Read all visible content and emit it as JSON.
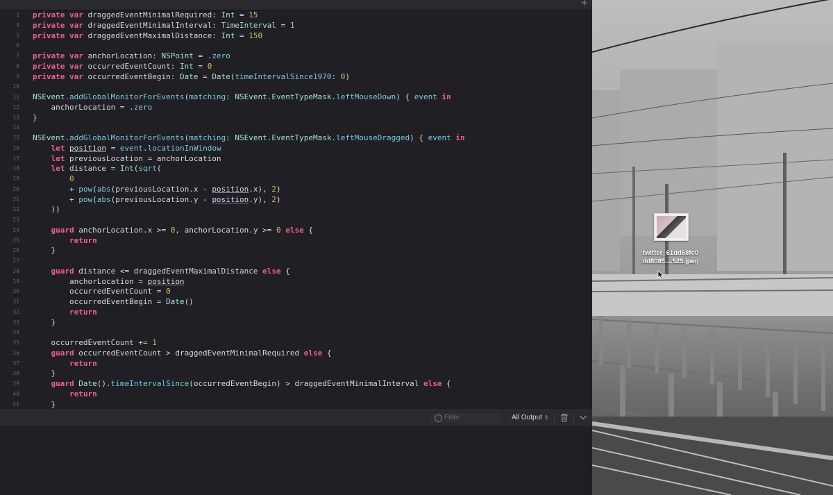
{
  "editor": {
    "add_tab": "+",
    "lines": [
      {
        "n": "3",
        "t": [
          [
            "kw",
            "private var "
          ],
          [
            "p",
            "draggedEventMinimalRequired: "
          ],
          [
            "typ",
            "Int"
          ],
          [
            "p",
            " = "
          ],
          [
            "num",
            "15"
          ]
        ]
      },
      {
        "n": "4",
        "t": [
          [
            "kw",
            "private var "
          ],
          [
            "p",
            "draggedEventMinimalInterval: "
          ],
          [
            "typ",
            "TimeInterval"
          ],
          [
            "p",
            " = "
          ],
          [
            "num",
            "1"
          ]
        ]
      },
      {
        "n": "5",
        "t": [
          [
            "kw",
            "private var "
          ],
          [
            "p",
            "draggedEventMaximalDistance: "
          ],
          [
            "typ",
            "Int"
          ],
          [
            "p",
            " = "
          ],
          [
            "num",
            "150"
          ]
        ]
      },
      {
        "n": "6",
        "t": []
      },
      {
        "n": "7",
        "t": [
          [
            "kw",
            "private var "
          ],
          [
            "p",
            "anchorLocation: "
          ],
          [
            "typ",
            "NSPoint"
          ],
          [
            "p",
            " = ."
          ],
          [
            "fn",
            "zero"
          ]
        ]
      },
      {
        "n": "8",
        "t": [
          [
            "kw",
            "private var "
          ],
          [
            "p",
            "occurredEventCount: "
          ],
          [
            "typ",
            "Int"
          ],
          [
            "p",
            " = "
          ],
          [
            "num",
            "0"
          ]
        ]
      },
      {
        "n": "9",
        "t": [
          [
            "kw",
            "private var "
          ],
          [
            "p",
            "occurredEventBegin: "
          ],
          [
            "typ",
            "Date"
          ],
          [
            "p",
            " = "
          ],
          [
            "typ",
            "Date"
          ],
          [
            "p",
            "("
          ],
          [
            "fn",
            "timeIntervalSince1970"
          ],
          [
            "p",
            ": "
          ],
          [
            "num",
            "0"
          ],
          [
            "p",
            ")"
          ]
        ]
      },
      {
        "n": "10",
        "t": []
      },
      {
        "n": "11",
        "t": [
          [
            "typ",
            "NSEvent"
          ],
          [
            "p",
            "."
          ],
          [
            "fn",
            "addGlobalMonitorForEvents"
          ],
          [
            "p",
            "("
          ],
          [
            "fn",
            "matching"
          ],
          [
            "p",
            ": "
          ],
          [
            "typ",
            "NSEvent"
          ],
          [
            "p",
            "."
          ],
          [
            "typ",
            "EventTypeMask"
          ],
          [
            "p",
            "."
          ],
          [
            "fn",
            "leftMouseDown"
          ],
          [
            "p",
            ") { "
          ],
          [
            "fn",
            "event"
          ],
          [
            "p",
            " "
          ],
          [
            "kw",
            "in"
          ]
        ]
      },
      {
        "n": "12",
        "t": [
          [
            "p",
            "    anchorLocation = ."
          ],
          [
            "fn",
            "zero"
          ]
        ]
      },
      {
        "n": "13",
        "t": [
          [
            "p",
            "}"
          ]
        ]
      },
      {
        "n": "14",
        "t": []
      },
      {
        "n": "15",
        "t": [
          [
            "typ",
            "NSEvent"
          ],
          [
            "p",
            "."
          ],
          [
            "fn",
            "addGlobalMonitorForEvents"
          ],
          [
            "p",
            "("
          ],
          [
            "fn",
            "matching"
          ],
          [
            "p",
            ": "
          ],
          [
            "typ",
            "NSEvent"
          ],
          [
            "p",
            "."
          ],
          [
            "typ",
            "EventTypeMask"
          ],
          [
            "p",
            "."
          ],
          [
            "fn",
            "leftMouseDragged"
          ],
          [
            "p",
            ") { "
          ],
          [
            "fn",
            "event"
          ],
          [
            "p",
            " "
          ],
          [
            "kw",
            "in"
          ]
        ]
      },
      {
        "n": "16",
        "t": [
          [
            "p",
            "    "
          ],
          [
            "kw",
            "let "
          ],
          [
            "u",
            "position"
          ],
          [
            "p",
            " = "
          ],
          [
            "fn",
            "event"
          ],
          [
            "p",
            "."
          ],
          [
            "fn",
            "locationInWindow"
          ]
        ]
      },
      {
        "n": "17",
        "t": [
          [
            "p",
            "    "
          ],
          [
            "kw",
            "let "
          ],
          [
            "p",
            "previousLocation = anchorLocation"
          ]
        ]
      },
      {
        "n": "18",
        "t": [
          [
            "p",
            "    "
          ],
          [
            "kw",
            "let "
          ],
          [
            "p",
            "distance = "
          ],
          [
            "typ",
            "Int"
          ],
          [
            "p",
            "("
          ],
          [
            "fn",
            "sqrt"
          ],
          [
            "p",
            "("
          ]
        ]
      },
      {
        "n": "19",
        "t": [
          [
            "p",
            "        "
          ],
          [
            "num",
            "0"
          ]
        ]
      },
      {
        "n": "20",
        "t": [
          [
            "p",
            "        + "
          ],
          [
            "fn",
            "pow"
          ],
          [
            "p",
            "("
          ],
          [
            "fn",
            "abs"
          ],
          [
            "p",
            "(previousLocation.x - "
          ],
          [
            "u",
            "position"
          ],
          [
            "p",
            ".x), "
          ],
          [
            "num",
            "2"
          ],
          [
            "p",
            ")"
          ]
        ]
      },
      {
        "n": "21",
        "t": [
          [
            "p",
            "        + "
          ],
          [
            "fn",
            "pow"
          ],
          [
            "p",
            "("
          ],
          [
            "fn",
            "abs"
          ],
          [
            "p",
            "(previousLocation.y - "
          ],
          [
            "u",
            "position"
          ],
          [
            "p",
            ".y), "
          ],
          [
            "num",
            "2"
          ],
          [
            "p",
            ")"
          ]
        ]
      },
      {
        "n": "22",
        "t": [
          [
            "p",
            "    ))"
          ]
        ]
      },
      {
        "n": "23",
        "t": []
      },
      {
        "n": "24",
        "t": [
          [
            "p",
            "    "
          ],
          [
            "kw",
            "guard "
          ],
          [
            "p",
            "anchorLocation.x >= "
          ],
          [
            "num",
            "0"
          ],
          [
            "p",
            ", anchorLocation.y >= "
          ],
          [
            "num",
            "0"
          ],
          [
            "p",
            " "
          ],
          [
            "kw",
            "else"
          ],
          [
            "p",
            " {"
          ]
        ]
      },
      {
        "n": "25",
        "t": [
          [
            "p",
            "        "
          ],
          [
            "kw",
            "return"
          ]
        ]
      },
      {
        "n": "26",
        "t": [
          [
            "p",
            "    }"
          ]
        ]
      },
      {
        "n": "27",
        "t": []
      },
      {
        "n": "28",
        "t": [
          [
            "p",
            "    "
          ],
          [
            "kw",
            "guard "
          ],
          [
            "p",
            "distance <= draggedEventMaximalDistance "
          ],
          [
            "kw",
            "else"
          ],
          [
            "p",
            " {"
          ]
        ]
      },
      {
        "n": "29",
        "t": [
          [
            "p",
            "        anchorLocation = "
          ],
          [
            "u",
            "position"
          ]
        ]
      },
      {
        "n": "30",
        "t": [
          [
            "p",
            "        occurredEventCount = "
          ],
          [
            "num",
            "0"
          ]
        ]
      },
      {
        "n": "31",
        "t": [
          [
            "p",
            "        occurredEventBegin = "
          ],
          [
            "typ",
            "Date"
          ],
          [
            "p",
            "()"
          ]
        ]
      },
      {
        "n": "32",
        "t": [
          [
            "p",
            "        "
          ],
          [
            "kw",
            "return"
          ]
        ]
      },
      {
        "n": "33",
        "t": [
          [
            "p",
            "    }"
          ]
        ]
      },
      {
        "n": "34",
        "t": []
      },
      {
        "n": "35",
        "t": [
          [
            "p",
            "    occurredEventCount += "
          ],
          [
            "num",
            "1"
          ]
        ]
      },
      {
        "n": "36",
        "t": [
          [
            "p",
            "    "
          ],
          [
            "kw",
            "guard "
          ],
          [
            "p",
            "occurredEventCount > draggedEventMinimalRequired "
          ],
          [
            "kw",
            "else"
          ],
          [
            "p",
            " {"
          ]
        ]
      },
      {
        "n": "37",
        "t": [
          [
            "p",
            "        "
          ],
          [
            "kw",
            "return"
          ]
        ]
      },
      {
        "n": "38",
        "t": [
          [
            "p",
            "    }"
          ]
        ]
      },
      {
        "n": "39",
        "t": [
          [
            "p",
            "    "
          ],
          [
            "kw",
            "guard "
          ],
          [
            "typ",
            "Date"
          ],
          [
            "p",
            "()."
          ],
          [
            "fn",
            "timeIntervalSince"
          ],
          [
            "p",
            "(occurredEventBegin) > draggedEventMinimalInterval "
          ],
          [
            "kw",
            "else"
          ],
          [
            "p",
            " {"
          ]
        ]
      },
      {
        "n": "40",
        "t": [
          [
            "p",
            "        "
          ],
          [
            "kw",
            "return"
          ]
        ]
      },
      {
        "n": "41",
        "t": [
          [
            "p",
            "    }"
          ]
        ]
      }
    ]
  },
  "debug_bar": {
    "filter_placeholder": "Filter",
    "output_selector": "All Output",
    "output_chevron": "⇕"
  },
  "desktop": {
    "file_name_line1": "twitter_61dd68fc0",
    "file_name_line2": "dd8085....525.jpeg"
  },
  "colors": {
    "editor_bg": "#1f1f24",
    "keyword": "#ef5f95",
    "number": "#d3bd6f",
    "type": "#a5e0d8",
    "function": "#7cc8e0",
    "plain": "#d7d7db"
  }
}
